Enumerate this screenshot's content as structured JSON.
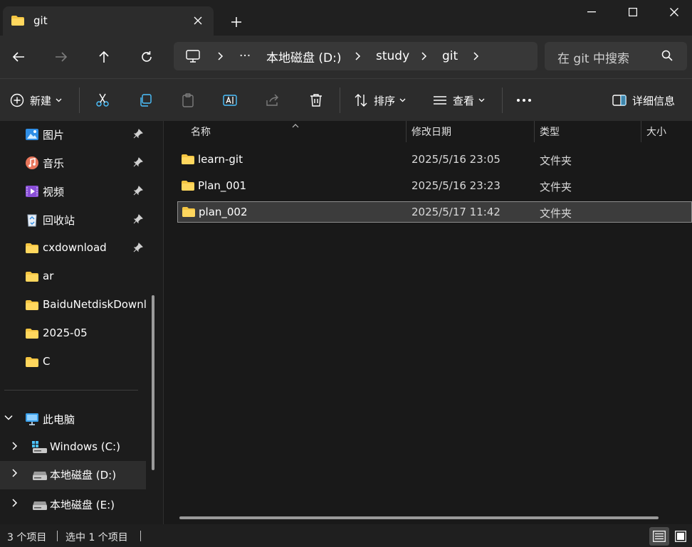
{
  "tab": {
    "title": "git"
  },
  "address": {
    "segments": [
      "本地磁盘 (D:)",
      "study",
      "git"
    ],
    "overflow": "···"
  },
  "search": {
    "placeholder": "在 git 中搜索"
  },
  "toolbar": {
    "new_label": "新建",
    "sort_label": "排序",
    "view_label": "查看",
    "details_label": "详细信息"
  },
  "sidebar": {
    "quick": [
      {
        "label": "图片",
        "icon": "pictures-icon",
        "pinned": true
      },
      {
        "label": "音乐",
        "icon": "music-icon",
        "pinned": true
      },
      {
        "label": "视频",
        "icon": "videos-icon",
        "pinned": true
      },
      {
        "label": "回收站",
        "icon": "recycle-bin-icon",
        "pinned": true
      },
      {
        "label": "cxdownload",
        "icon": "folder-icon",
        "pinned": true
      },
      {
        "label": "ar",
        "icon": "folder-icon",
        "pinned": false
      },
      {
        "label": "BaiduNetdiskDownload",
        "icon": "folder-icon",
        "pinned": false
      },
      {
        "label": "2025-05",
        "icon": "folder-icon",
        "pinned": false
      },
      {
        "label": "C",
        "icon": "folder-icon",
        "pinned": false
      }
    ],
    "this_pc": "此电脑",
    "drives": [
      {
        "label": "Windows (C:)",
        "icon": "windows-drive-icon"
      },
      {
        "label": "本地磁盘 (D:)",
        "icon": "drive-icon",
        "selected": true
      },
      {
        "label": "本地磁盘 (E:)",
        "icon": "drive-icon"
      }
    ]
  },
  "columns": {
    "name": "名称",
    "date": "修改日期",
    "type": "类型",
    "size": "大小"
  },
  "files": [
    {
      "name": "learn-git",
      "date": "2025/5/16 23:05",
      "type": "文件夹"
    },
    {
      "name": "Plan_001",
      "date": "2025/5/16 23:23",
      "type": "文件夹"
    },
    {
      "name": "plan_002",
      "date": "2025/5/17 11:42",
      "type": "文件夹"
    }
  ],
  "status": {
    "count": "3 个项目",
    "selected": "选中 1 个项目"
  },
  "colors": {
    "folder": "#f4c542",
    "accent": "#4cc2ff"
  }
}
